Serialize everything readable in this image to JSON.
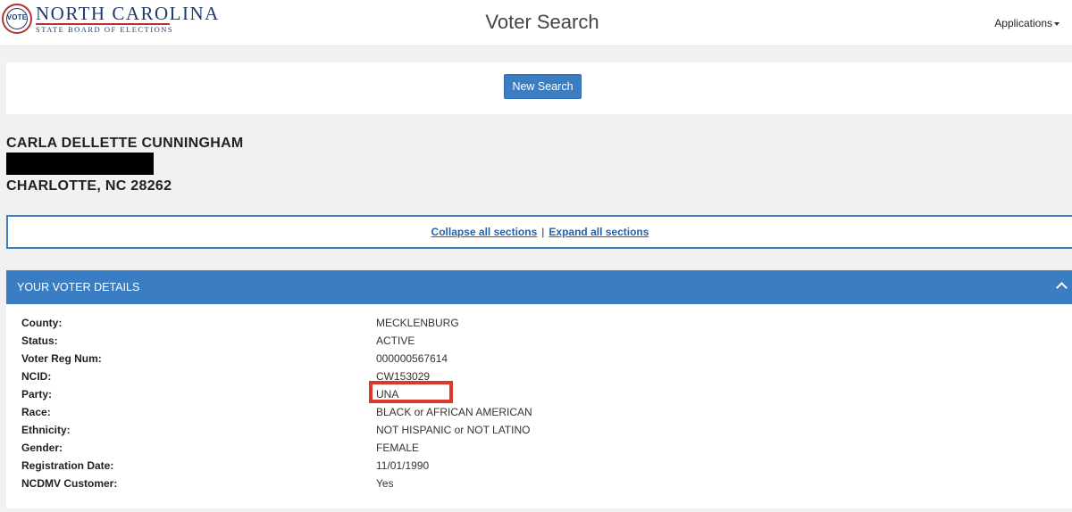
{
  "header": {
    "logo": {
      "seal_text": "VOTE",
      "main_text": "NORTH CAROLINA",
      "sub_text": "STATE BOARD OF ELECTIONS",
      "icon": "nc-seal-icon"
    },
    "title": "Voter Search",
    "applications_label": "Applications"
  },
  "search": {
    "new_search_label": "New Search"
  },
  "voter": {
    "name": "CARLA DELLETTE CUNNINGHAM",
    "city_line": "CHARLOTTE, NC 28262"
  },
  "toggles": {
    "collapse_label": "Collapse all sections",
    "separator": "|",
    "expand_label": "Expand all sections"
  },
  "details": {
    "section_title": "YOUR VOTER DETAILS",
    "rows": [
      {
        "label": "County:",
        "value": "MECKLENBURG"
      },
      {
        "label": "Status:",
        "value": "ACTIVE"
      },
      {
        "label": "Voter Reg Num:",
        "value": "000000567614"
      },
      {
        "label": "NCID:",
        "value": "CW153029"
      },
      {
        "label": "Party:",
        "value": "UNA"
      },
      {
        "label": "Race:",
        "value": "BLACK or AFRICAN AMERICAN"
      },
      {
        "label": "Ethnicity:",
        "value": "NOT HISPANIC or NOT LATINO"
      },
      {
        "label": "Gender:",
        "value": "FEMALE"
      },
      {
        "label": "Registration Date:",
        "value": "11/01/1990"
      },
      {
        "label": "NCDMV Customer:",
        "value": "Yes"
      }
    ]
  },
  "colors": {
    "accent": "#3a7dc3",
    "link": "#2860a8",
    "highlight": "#d93a2c",
    "brand_navy": "#1f3a6a",
    "brand_red": "#b5312f"
  }
}
